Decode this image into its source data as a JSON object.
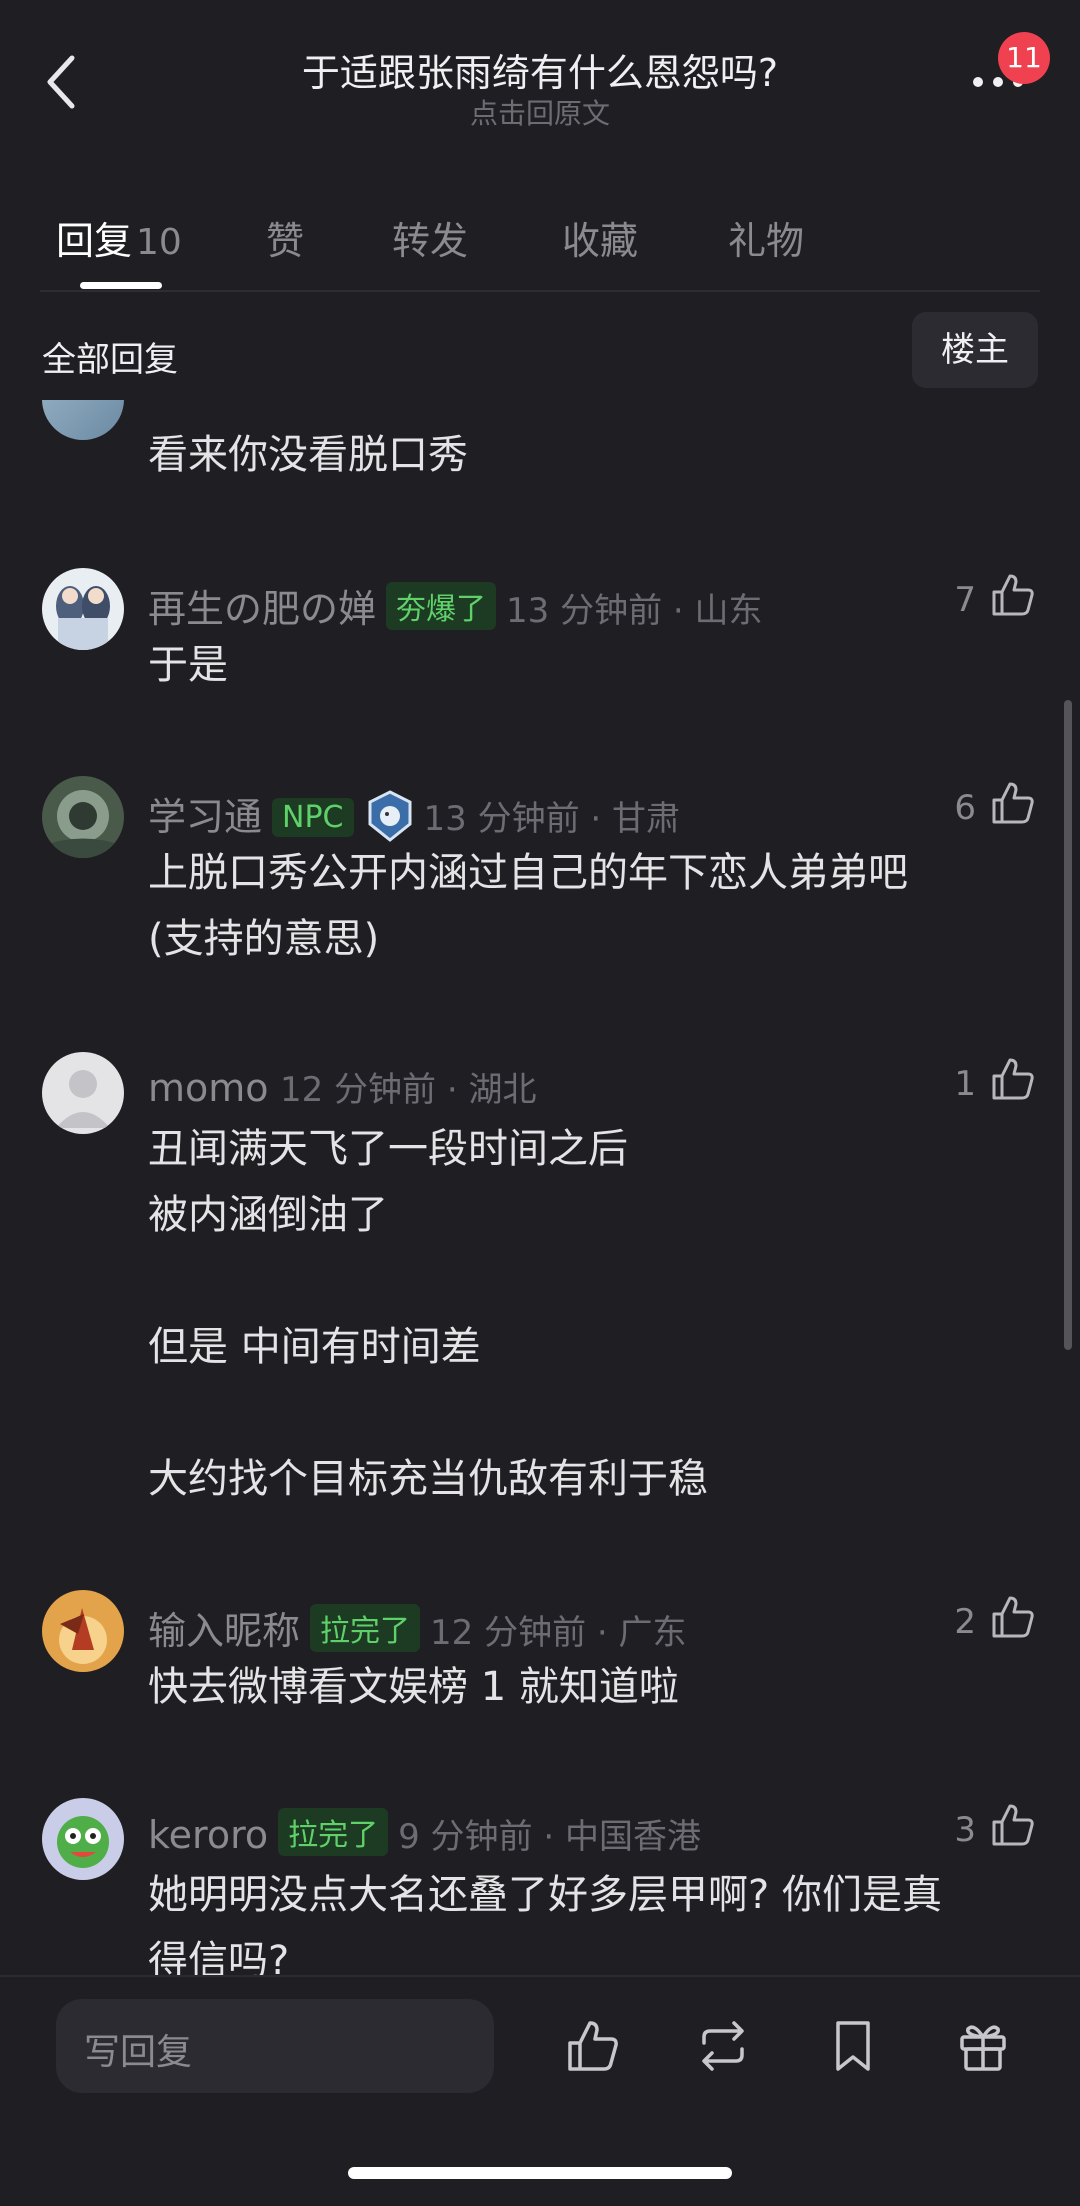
{
  "header": {
    "title": "于适跟张雨绮有什么恩怨吗?",
    "subtitle": "点击回原文",
    "notif_count": "11"
  },
  "tabs": [
    {
      "label": "回复",
      "count": "10",
      "active": true
    },
    {
      "label": "赞"
    },
    {
      "label": "转发"
    },
    {
      "label": "收藏"
    },
    {
      "label": "礼物"
    }
  ],
  "section": {
    "title": "全部回复",
    "op_button": "楼主"
  },
  "comments": [
    {
      "lines": [
        "看来你没看脱口秀"
      ]
    },
    {
      "name": "再生の肥の婵",
      "tag": "夯爆了",
      "time": "13 分钟前 · 山东",
      "likes": "7",
      "lines": [
        "于是"
      ]
    },
    {
      "name": "学习通",
      "tag": "NPC",
      "time": "13 分钟前 · 甘肃",
      "likes": "6",
      "lines": [
        "上脱口秀公开内涵过自己的年下恋人弟弟吧",
        "(支持的意思)"
      ]
    },
    {
      "name": "momo",
      "time": "12 分钟前 · 湖北",
      "likes": "1",
      "lines": [
        "丑闻满天飞了一段时间之后",
        "被内涵倒油了",
        "",
        "但是 中间有时间差",
        "",
        "大约找个目标充当仇敌有利于稳"
      ]
    },
    {
      "name": "输入昵称",
      "tag": "拉完了",
      "time": "12 分钟前 · 广东",
      "likes": "2",
      "lines": [
        "快去微博看文娱榜 1 就知道啦"
      ]
    },
    {
      "name": "keroro",
      "tag": "拉完了",
      "time": "9 分钟前 · 中国香港",
      "likes": "3",
      "lines": [
        "她明明没点大名还叠了好多层甲啊? 你们是真",
        "得信吗?"
      ]
    }
  ],
  "bottom_bar": {
    "reply_placeholder": "写回复"
  },
  "colors": {
    "background": "#1f1e23",
    "tag_green": "#5fd16a",
    "badge_red": "#ef4150"
  }
}
